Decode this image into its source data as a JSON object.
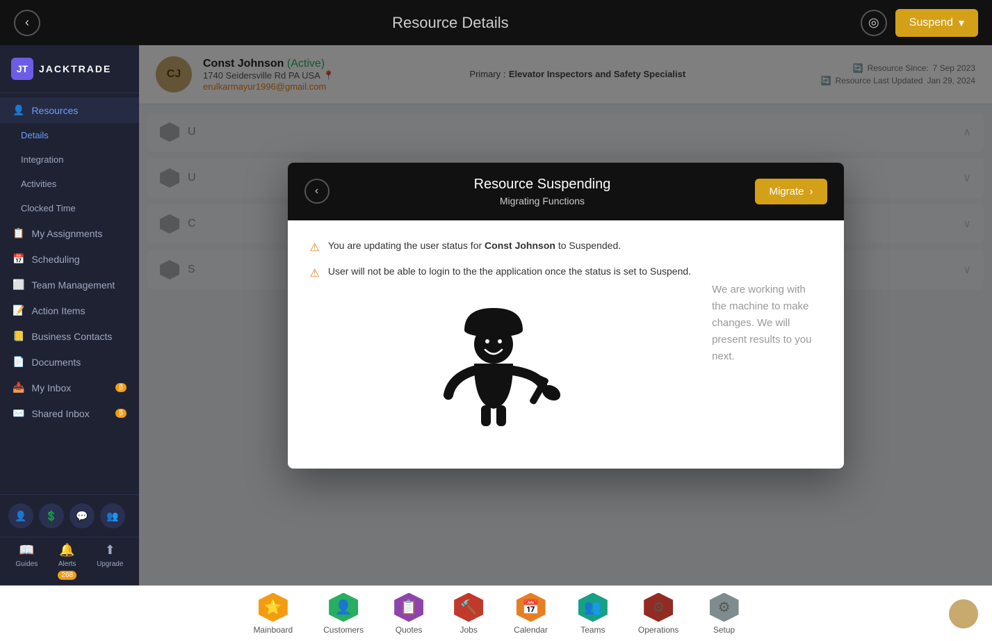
{
  "app": {
    "name": "JACKTRADE",
    "logo_letters": "jt"
  },
  "topbar": {
    "title": "Resource Details",
    "back_label": "‹",
    "compass_label": "◎",
    "suspend_label": "Suspend",
    "suspend_chevron": "▾"
  },
  "sidebar": {
    "items": [
      {
        "label": "Resources",
        "icon": "👤",
        "active": true
      },
      {
        "label": "Details",
        "icon": "",
        "sub": true,
        "active_sub": true
      },
      {
        "label": "Integration",
        "icon": "",
        "sub": true
      },
      {
        "label": "Activities",
        "icon": "",
        "sub": true
      },
      {
        "label": "Clocked Time",
        "icon": "",
        "sub": true
      },
      {
        "label": "My Assignments",
        "icon": "📋"
      },
      {
        "label": "Scheduling",
        "icon": "📅"
      },
      {
        "label": "Team Management",
        "icon": "⬜"
      },
      {
        "label": "Action Items",
        "icon": "📝"
      },
      {
        "label": "Business Contacts",
        "icon": "📒"
      },
      {
        "label": "Documents",
        "icon": "📄"
      },
      {
        "label": "My Inbox",
        "icon": "📥",
        "badge": ""
      },
      {
        "label": "Shared Inbox",
        "icon": "✉️",
        "badge": "β"
      }
    ],
    "bottom_actions": [
      {
        "label": "Guides",
        "icon": "📖"
      },
      {
        "label": "Alerts",
        "icon": "🔔",
        "badge": "268"
      },
      {
        "label": "Upgrade",
        "icon": "⬆"
      }
    ],
    "footer_icons": [
      "👤",
      "💲",
      "💬",
      "👥"
    ]
  },
  "resource": {
    "initials": "CJ",
    "name": "Const Johnson",
    "status": "(Active)",
    "address": "1740 Seidersville Rd PA USA",
    "email": "erulkarmayur1996@gmail.com",
    "primary_label": "Primary :",
    "primary_role": "Elevator Inspectors and Safety Specialist",
    "resource_since_label": "Resource Since:",
    "resource_since_date": "7 Sep 2023",
    "resource_updated_label": "Resource Last Updated",
    "resource_updated_date": "Jan 29, 2024"
  },
  "content_rows": [
    {
      "label": "U",
      "expanded": false
    },
    {
      "label": "U",
      "expanded": false
    },
    {
      "label": "C",
      "expanded": false
    },
    {
      "label": "S",
      "expanded": false
    }
  ],
  "modal": {
    "title": "Resource Suspending",
    "subtitle": "Migrating Functions",
    "back_label": "‹",
    "migrate_label": "Migrate",
    "migrate_chevron": "›",
    "warning1": "You are updating the user status for ",
    "warning1_bold": "Const Johnson",
    "warning1_end": " to Suspended.",
    "warning2": "User will not be able to login to the the application once the status is set to Suspend.",
    "working_text": "We are working with the machine to make changes. We will present results to you next.",
    "worker_emoji": "👷"
  },
  "bottom_nav": {
    "items": [
      {
        "label": "Mainboard",
        "icon": "⭐",
        "color": "yellow"
      },
      {
        "label": "Customers",
        "icon": "👤",
        "color": "green"
      },
      {
        "label": "Quotes",
        "icon": "📋",
        "color": "purple"
      },
      {
        "label": "Jobs",
        "icon": "🔨",
        "color": "red"
      },
      {
        "label": "Calendar",
        "icon": "📅",
        "color": "orange"
      },
      {
        "label": "Teams",
        "icon": "👥",
        "color": "teal"
      },
      {
        "label": "Operations",
        "icon": "⚙",
        "color": "dark-red"
      },
      {
        "label": "Setup",
        "icon": "⚙",
        "color": "gray"
      }
    ]
  }
}
